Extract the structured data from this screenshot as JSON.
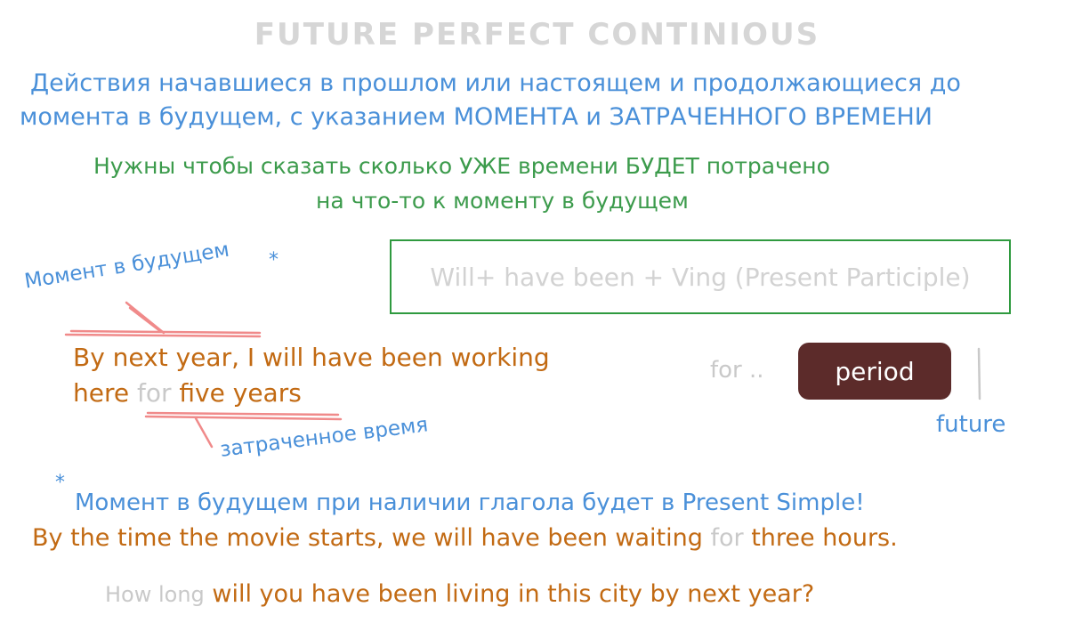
{
  "title": "FUTURE PERFECT CONTINIOUS",
  "definition": {
    "line1": "Действия начавшиеся в прошлом или настоящем и продолжающиеся до",
    "line2": "момента в будущем, с указанием МОМЕНТА и ЗАТРАЧЕННОГО ВРЕМЕНИ"
  },
  "usage": {
    "line1": "Нужны чтобы сказать сколько УЖЕ времени БУДЕТ потрачено",
    "line2": "на что-то к моменту в будущем"
  },
  "formula": "Will+ have been + Ving (Present Participle)",
  "labels": {
    "moment_future": "Момент в будущем",
    "asterisk": "*",
    "time_spent": "затраченное время",
    "for_dots": "for ..",
    "period": "period",
    "future": "future"
  },
  "example1": {
    "line1": "By next year, I will have been working",
    "line2_start": "here",
    "line2_for": "for",
    "line2_end": "five years"
  },
  "note": {
    "asterisk": "*",
    "text": "Момент в будущем при наличии глагола будет в Present Simple!"
  },
  "example2": {
    "part1": "By the time the movie starts, we will have been waiting",
    "for": "for",
    "part2": "three hours."
  },
  "example3": {
    "how_long": "How long",
    "rest": "will you have been living in this city by next year?"
  },
  "colors": {
    "title": "#d6d6d6",
    "blue": "#4a90d9",
    "green": "#3c9b4c",
    "orange": "#c26a13",
    "grey": "#c9c9c9",
    "box_border": "#2f9a3f",
    "pill": "#5c2b2a",
    "underline": "#f08a8a"
  }
}
